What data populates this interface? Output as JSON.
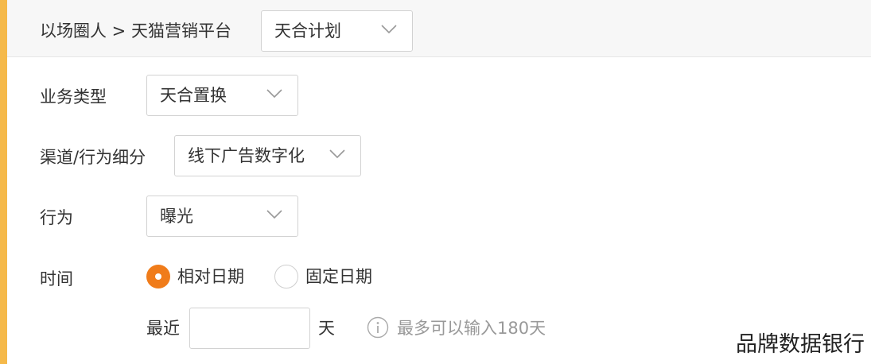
{
  "header": {
    "breadcrumb": "以场圈人 > 天猫营销平台",
    "plan_select": "天合计划"
  },
  "form": {
    "business_type": {
      "label": "业务类型",
      "value": "天合置换"
    },
    "channel": {
      "label": "渠道/行为细分",
      "value": "线下广告数字化"
    },
    "action": {
      "label": "行为",
      "value": "曝光"
    },
    "time": {
      "label": "时间",
      "options": [
        {
          "label": "相对日期",
          "checked": true
        },
        {
          "label": "固定日期",
          "checked": false
        }
      ],
      "recent_prefix": "最近",
      "days_value": "",
      "days_unit": "天",
      "hint": "最多可以输入180天"
    }
  },
  "watermark": "品牌数据银行",
  "colors": {
    "accent": "#f5b94a",
    "radio_active": "#f07c1a"
  },
  "icons": {
    "dropdown": "chevron-down-icon",
    "info": "info-icon"
  }
}
